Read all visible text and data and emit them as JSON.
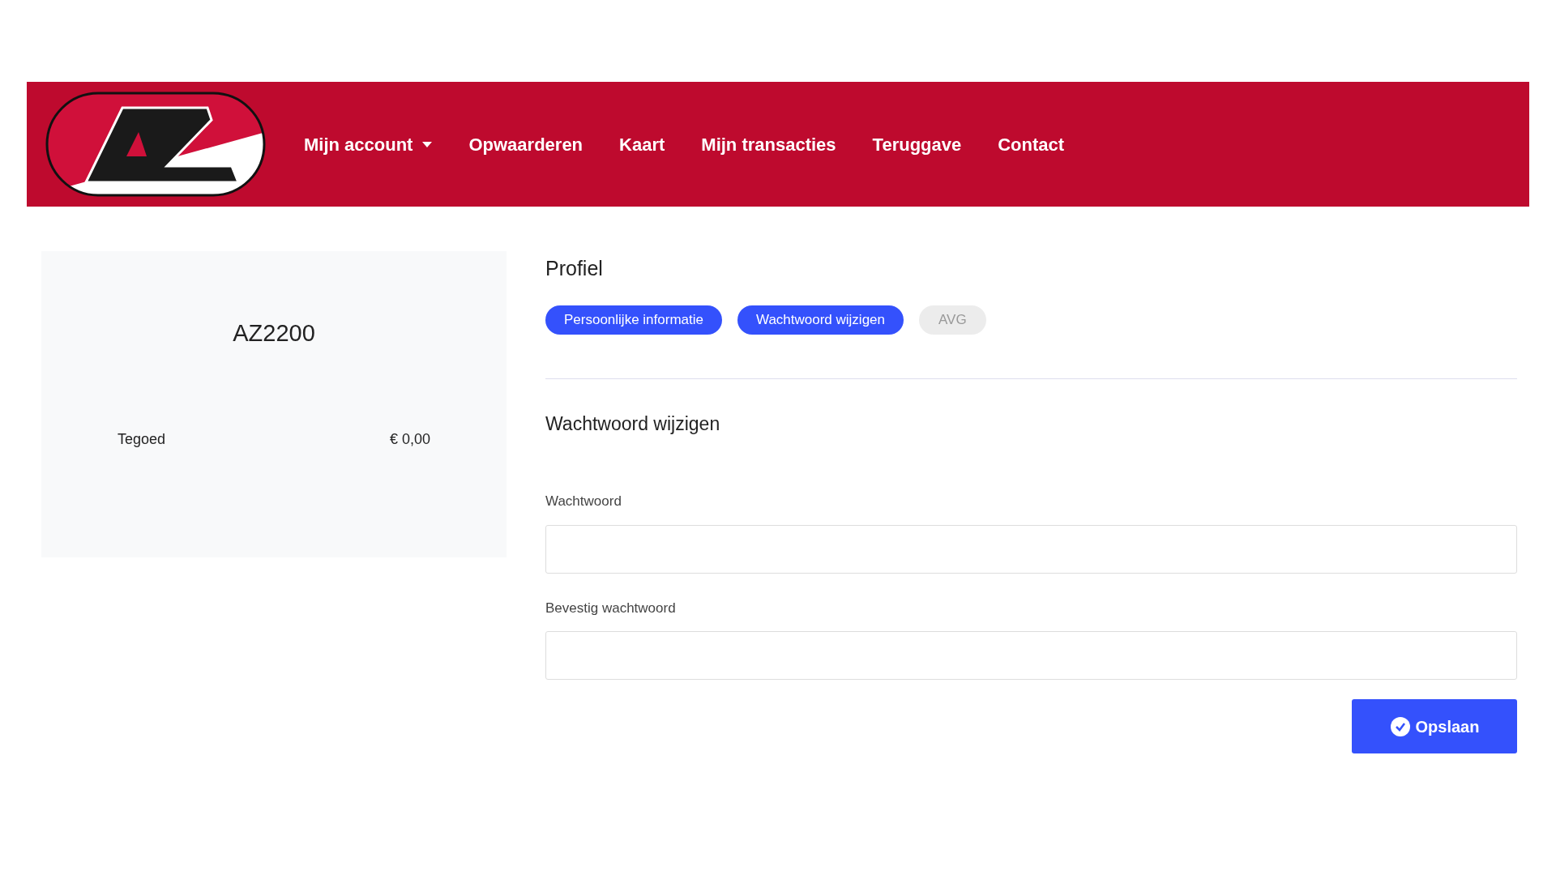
{
  "nav": {
    "items": [
      {
        "label": "Mijn account",
        "dropdown": true
      },
      {
        "label": "Opwaarderen",
        "dropdown": false
      },
      {
        "label": "Kaart",
        "dropdown": false
      },
      {
        "label": "Mijn transacties",
        "dropdown": false
      },
      {
        "label": "Teruggave",
        "dropdown": false
      },
      {
        "label": "Contact",
        "dropdown": false
      }
    ]
  },
  "account_card": {
    "card_number": "AZ2200",
    "balance_label": "Tegoed",
    "balance": "€ 0,00"
  },
  "profile": {
    "title": "Profiel",
    "tabs": [
      {
        "label": "Persoonlijke informatie",
        "disabled": false
      },
      {
        "label": "Wachtwoord wijzigen",
        "disabled": false
      },
      {
        "label": "AVG",
        "disabled": true
      }
    ],
    "section_title": "Wachtwoord wijzigen",
    "fields": [
      {
        "label": "Wachtwoord"
      },
      {
        "label": "Bevestig wachtwoord"
      }
    ],
    "save_button": "Opslaan"
  }
}
